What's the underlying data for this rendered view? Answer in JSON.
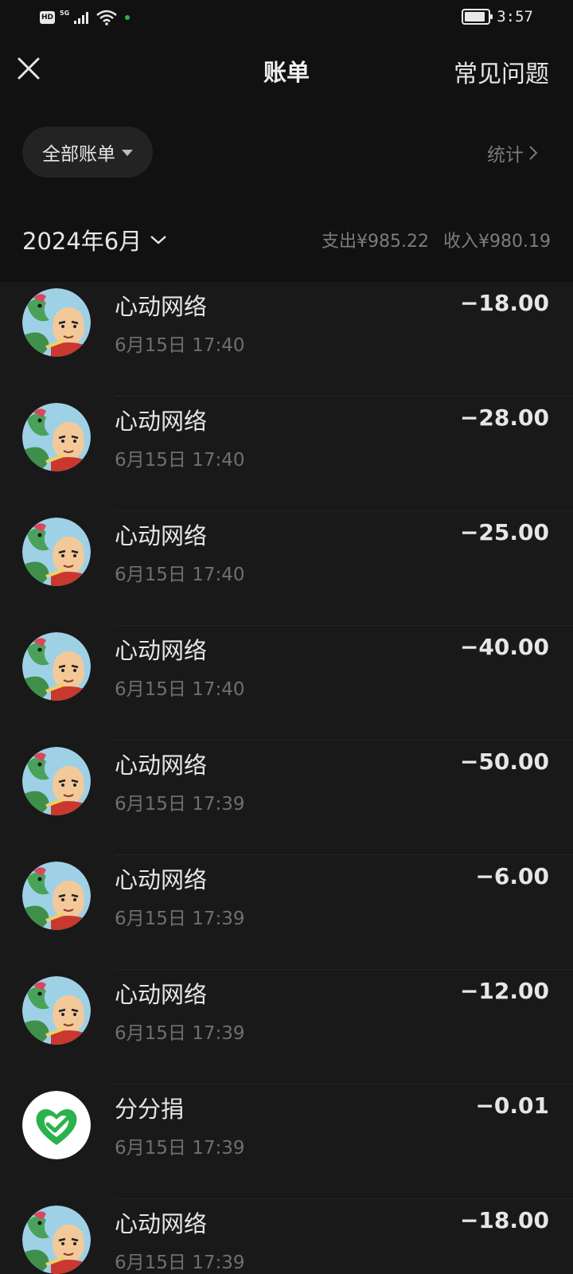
{
  "status_bar": {
    "hd": "HD",
    "network": "5G",
    "time": "3:57",
    "battery_level": 0.9
  },
  "nav": {
    "title": "账单",
    "faq": "常见问题"
  },
  "filter": {
    "label": "全部账单",
    "stats": "统计"
  },
  "month": {
    "label": "2024年6月",
    "expense": "支出¥985.22",
    "income": "收入¥980.19"
  },
  "transactions": [
    {
      "name": "心动网络",
      "time": "6月15日 17:40",
      "amount": "−18.00",
      "avatar": "game-character-avatar"
    },
    {
      "name": "心动网络",
      "time": "6月15日 17:40",
      "amount": "−28.00",
      "avatar": "game-character-avatar"
    },
    {
      "name": "心动网络",
      "time": "6月15日 17:40",
      "amount": "−25.00",
      "avatar": "game-character-avatar"
    },
    {
      "name": "心动网络",
      "time": "6月15日 17:40",
      "amount": "−40.00",
      "avatar": "game-character-avatar"
    },
    {
      "name": "心动网络",
      "time": "6月15日 17:39",
      "amount": "−50.00",
      "avatar": "game-character-avatar"
    },
    {
      "name": "心动网络",
      "time": "6月15日 17:39",
      "amount": "−6.00",
      "avatar": "game-character-avatar"
    },
    {
      "name": "心动网络",
      "time": "6月15日 17:39",
      "amount": "−12.00",
      "avatar": "game-character-avatar"
    },
    {
      "name": "分分捐",
      "time": "6月15日 17:39",
      "amount": "−0.01",
      "avatar": "green-heart-logo"
    },
    {
      "name": "心动网络",
      "time": "6月15日 17:39",
      "amount": "−18.00",
      "avatar": "game-character-avatar"
    }
  ],
  "colors": {
    "background": "#111111",
    "list_background": "#191919",
    "accent_green": "#2bb24c"
  }
}
